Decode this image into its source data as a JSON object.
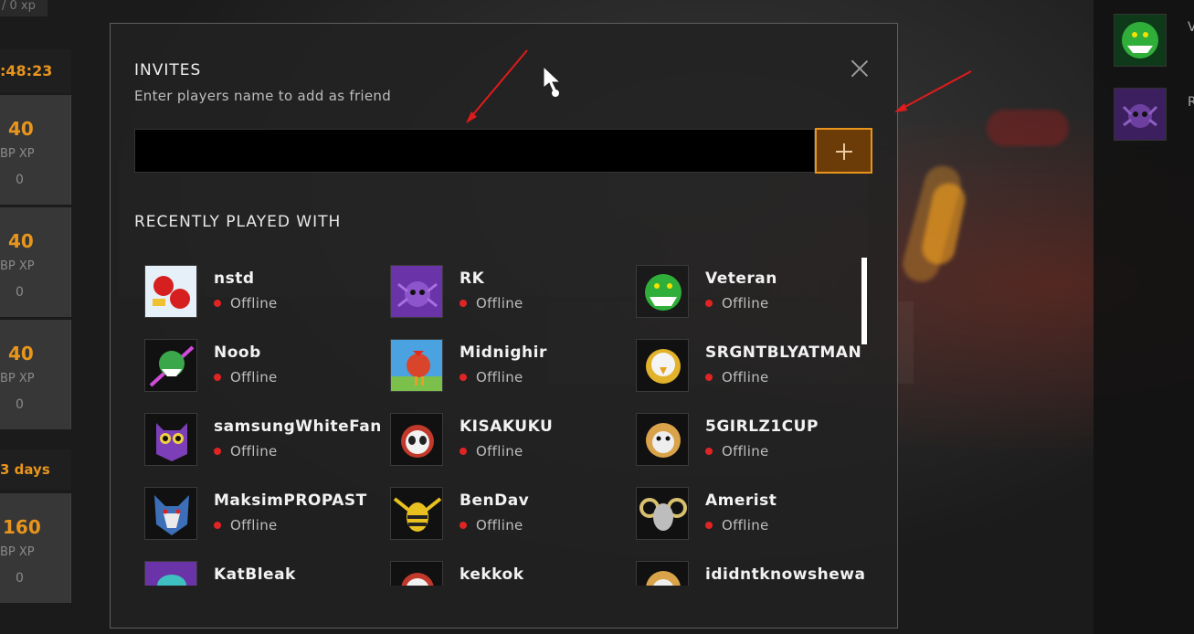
{
  "left_panel": {
    "xp_top": "/ 0 xp",
    "timer": ":48:23",
    "cards": [
      {
        "value": "40",
        "label": "BP XP",
        "sub": "0"
      },
      {
        "value": "40",
        "label": "BP XP",
        "sub": "0"
      },
      {
        "value": "40",
        "label": "BP XP",
        "sub": "0"
      },
      {
        "value": "160",
        "label": "BP XP",
        "sub": "0"
      }
    ],
    "days": "3 days"
  },
  "right_panel": {
    "friends": [
      {
        "letter": "V",
        "avatar_icon": "crocodile-green-icon"
      },
      {
        "letter": "R",
        "avatar_icon": "spider-purple-icon"
      }
    ]
  },
  "modal": {
    "title": "INVITES",
    "subtitle": "Enter players name to add as friend",
    "search": {
      "value": "",
      "placeholder": ""
    },
    "add_icon": "plus-icon",
    "close_icon": "close-icon",
    "recent_title": "RECENTLY PLAYED WITH",
    "players": [
      {
        "name": "nstd",
        "status": "Offline",
        "avatar": "boxing-glove-icon"
      },
      {
        "name": "RK",
        "status": "Offline",
        "avatar": "spider-purple-icon"
      },
      {
        "name": "Veteran",
        "status": "Offline",
        "avatar": "crocodile-green-icon"
      },
      {
        "name": "Noob",
        "status": "Offline",
        "avatar": "crocodile-pink-icon"
      },
      {
        "name": "Midnighir",
        "status": "Offline",
        "avatar": "rooster-icon"
      },
      {
        "name": "SRGNTBLYATMAN",
        "status": "Offline",
        "avatar": "eagle-icon"
      },
      {
        "name": "samsungWhiteFang",
        "status": "Offline",
        "avatar": "owl-purple-icon"
      },
      {
        "name": "KISAKUKU",
        "status": "Offline",
        "avatar": "panda-icon"
      },
      {
        "name": "5GIRLZ1CUP",
        "status": "Offline",
        "avatar": "bulldog-icon"
      },
      {
        "name": "MaksimPROPAST",
        "status": "Offline",
        "avatar": "wolf-icon"
      },
      {
        "name": "BenDav",
        "status": "Offline",
        "avatar": "hornet-icon"
      },
      {
        "name": "Amerist",
        "status": "Offline",
        "avatar": "ram-icon"
      },
      {
        "name": "KatBleak",
        "status": "",
        "avatar": "octopus-icon"
      },
      {
        "name": "kekkok",
        "status": "",
        "avatar": "panda-icon"
      },
      {
        "name": "ididntknowshewas",
        "status": "",
        "avatar": "bulldog-icon"
      }
    ]
  },
  "colors": {
    "accent": "#e8951c",
    "offline": "#e02424",
    "annotation_arrow": "#e01b1b"
  }
}
